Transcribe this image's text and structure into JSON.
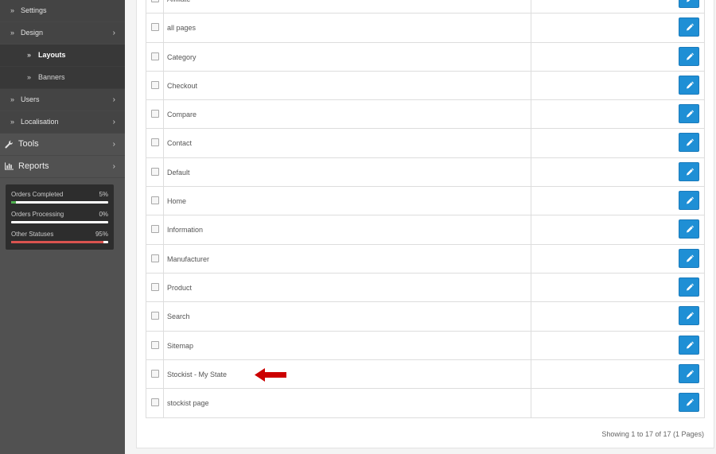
{
  "sidebar": {
    "items": [
      {
        "label": "Settings",
        "type": "sub",
        "has_chevron": false
      },
      {
        "label": "Design",
        "type": "sub",
        "has_chevron": true
      },
      {
        "label": "Layouts",
        "type": "subsub",
        "active": true
      },
      {
        "label": "Banners",
        "type": "subsub",
        "active": false
      },
      {
        "label": "Users",
        "type": "sub",
        "has_chevron": true
      },
      {
        "label": "Localisation",
        "type": "sub",
        "has_chevron": true
      },
      {
        "label": "Tools",
        "type": "top",
        "icon": "wrench-icon"
      },
      {
        "label": "Reports",
        "type": "top",
        "icon": "bar-chart-icon"
      }
    ]
  },
  "status": [
    {
      "label": "Orders Completed",
      "percent": "5%",
      "fraction": 0.05,
      "color": "#4cae4c"
    },
    {
      "label": "Orders Processing",
      "percent": "0%",
      "fraction": 0.0,
      "color": "#1f8fd5"
    },
    {
      "label": "Other Statuses",
      "percent": "95%",
      "fraction": 0.95,
      "color": "#d9534f"
    }
  ],
  "layouts": [
    {
      "name": "Affiliate"
    },
    {
      "name": "all pages"
    },
    {
      "name": "Category"
    },
    {
      "name": "Checkout"
    },
    {
      "name": "Compare"
    },
    {
      "name": "Contact"
    },
    {
      "name": "Default"
    },
    {
      "name": "Home"
    },
    {
      "name": "Information"
    },
    {
      "name": "Manufacturer"
    },
    {
      "name": "Product"
    },
    {
      "name": "Search"
    },
    {
      "name": "Sitemap"
    },
    {
      "name": "Stockist - My State",
      "annotated": true
    },
    {
      "name": "stockist page"
    }
  ],
  "pagination": {
    "text": "Showing 1 to 17 of 17 (1 Pages)"
  },
  "colors": {
    "edit_button": "#1f8fd5",
    "annotation_arrow": "#cc0000"
  }
}
